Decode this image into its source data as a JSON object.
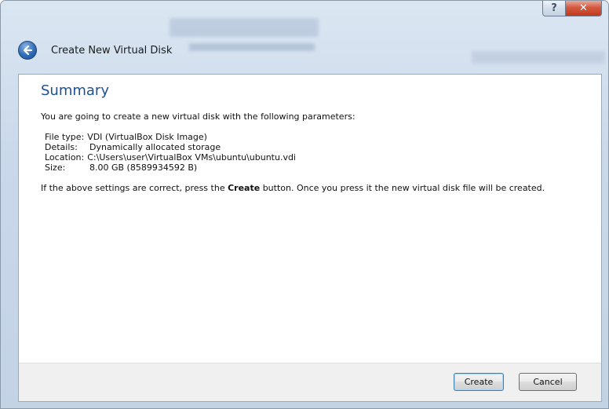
{
  "window": {
    "help_glyph": "?",
    "close_glyph": "✕"
  },
  "header": {
    "title": "Create New Virtual Disk"
  },
  "summary": {
    "heading": "Summary",
    "intro": "You are going to create a new virtual disk with the following parameters:",
    "params": [
      {
        "label": "File type:",
        "value": "VDI (VirtualBox Disk Image)"
      },
      {
        "label": "Details:",
        "value": "Dynamically allocated storage"
      },
      {
        "label": "Location:",
        "value": "C:\\Users\\user\\VirtualBox VMs\\ubuntu\\ubuntu.vdi"
      },
      {
        "label": "Size:",
        "value": "8.00 GB (8589934592 B)"
      }
    ],
    "outro_before": "If the above settings are correct, press the ",
    "outro_bold": "Create",
    "outro_after": " button. Once you press it the new virtual disk file will be created."
  },
  "buttons": {
    "create_label": "Create",
    "cancel_label": "Cancel"
  },
  "colors": {
    "heading": "#1e4f96",
    "close_button": "#c3391c",
    "default_button_border": "#3c7fb1"
  }
}
